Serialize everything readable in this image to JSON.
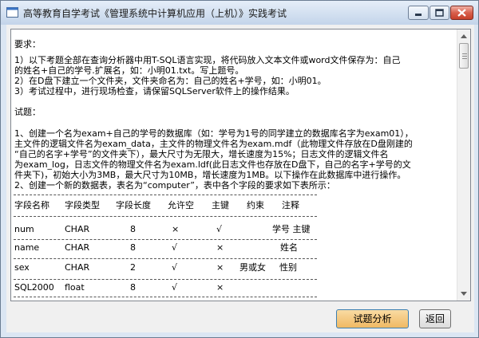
{
  "window": {
    "title": "高等教育自学考试《管理系统中计算机应用（上机）》实践考试"
  },
  "content": {
    "lines": [
      "要求：",
      "1）以下考题全部在查询分析器中用T-SQL语言实现，将代码放入文本文件或word文件保存为：自己",
      "的姓名+自己的学号.扩展名，如：小明01.txt。写上题号。",
      "2）在D盘下建立一个文件夹，文件夹命名为：自己的姓名+学号，如：小明01。",
      "3）考试过程中，进行现场检查，请保留SQLServer软件上的操作结果。",
      "试题：",
      "1、创建一个名为exam+自己的学号的数据库（如：学号为1号的同学建立的数据库名字为exam01），",
      "主文件的逻辑文件名为exam_data，主文件的物理文件名为exam.mdf（此物理文件存放在D盘刚建的",
      "“自己的名字+学号”的文件夹下），最大尺寸为无限大，增长速度为15%；日志文件的逻辑文件名",
      "为exam_log，日志文件的物理文件名为exam.ldf(此日志文件也存放在D盘下，自己的名字+学号的文",
      "件夹下)，初始大小为3MB，最大尺寸为10MB，增长速度为1MB。以下操作在此数据库中进行操作。",
      "2、创建一个新的数据表，表名为“computer”，表中各个字段的要求如下表所示："
    ],
    "table": {
      "headers": [
        "字段名称",
        "字段类型",
        "字段长度",
        "允许空",
        "主键",
        "约束",
        "注释"
      ],
      "rows": [
        [
          "num",
          "CHAR",
          "8",
          "×",
          "√",
          "",
          "学号 主键"
        ],
        [
          "name",
          "CHAR",
          "8",
          "√",
          "×",
          "",
          "姓名"
        ],
        [
          "sex",
          "CHAR",
          "2",
          "√",
          "×",
          "男或女",
          "性别"
        ],
        [
          "SQL2000",
          "float",
          "8",
          "√",
          "×",
          "",
          ""
        ]
      ]
    }
  },
  "buttons": {
    "analyze": "试题分析",
    "back": "返回"
  },
  "colors": {
    "titlebar": "#d4e1f1",
    "close_button": "#c7402a",
    "analyze_button": "#f0b963",
    "focus_border": "#3c7fb1"
  },
  "icons": {
    "app": "app-window-icon",
    "minimize": "minimize-icon",
    "maximize": "maximize-icon",
    "close": "close-icon",
    "scroll_up": "arrow-up-icon",
    "scroll_down": "arrow-down-icon"
  }
}
